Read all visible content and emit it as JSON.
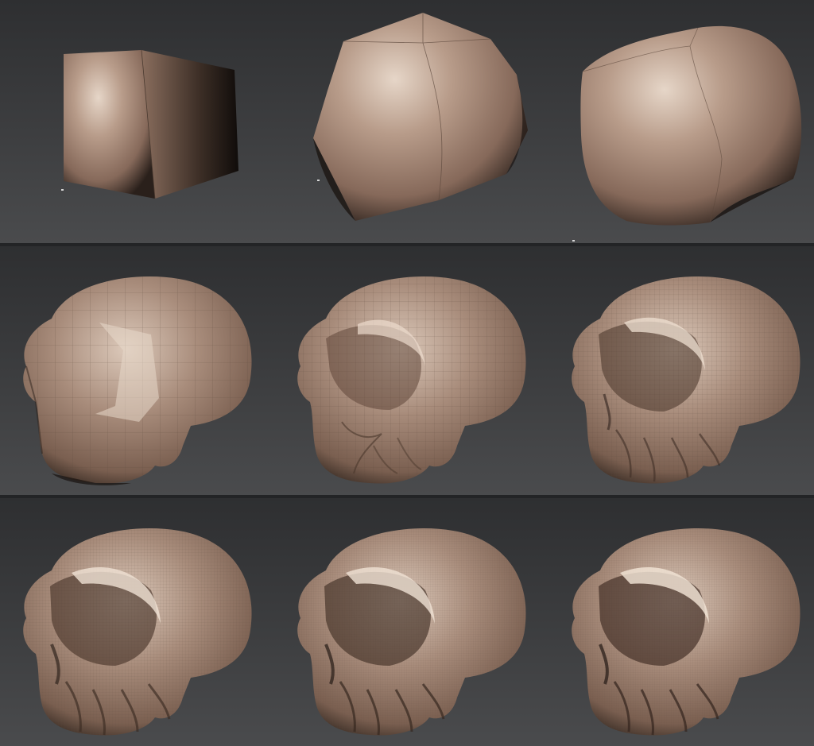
{
  "colors": {
    "background": "#3a3b3d",
    "divider": "#232426",
    "clay_base": "#a88c7b",
    "clay_highlight": "#e2d2c4",
    "clay_shadow": "#1e1814",
    "wireframe": "#5a463a"
  },
  "layout": {
    "rows": [
      {
        "name": "row-1",
        "models": [
          {
            "name": "base-cube-model",
            "shape": "cube",
            "subdivision_level": 0
          },
          {
            "name": "subdivided-cube-model",
            "shape": "rounded-cube",
            "subdivision_level": 1
          },
          {
            "name": "smoothed-blob-model",
            "shape": "blob",
            "subdivision_level": 2
          }
        ]
      },
      {
        "name": "row-2",
        "models": [
          {
            "name": "rough-skull-blockout-model",
            "shape": "skull",
            "subdivision_level": 1
          },
          {
            "name": "skull-refined-model",
            "shape": "skull",
            "subdivision_level": 2
          },
          {
            "name": "skull-detailed-model",
            "shape": "skull",
            "subdivision_level": 3
          }
        ]
      },
      {
        "name": "row-3",
        "models": [
          {
            "name": "skull-level-4-model",
            "shape": "skull",
            "subdivision_level": 4
          },
          {
            "name": "skull-level-5-model",
            "shape": "skull",
            "subdivision_level": 5
          },
          {
            "name": "skull-level-6-model",
            "shape": "skull",
            "subdivision_level": 6
          }
        ]
      }
    ]
  }
}
